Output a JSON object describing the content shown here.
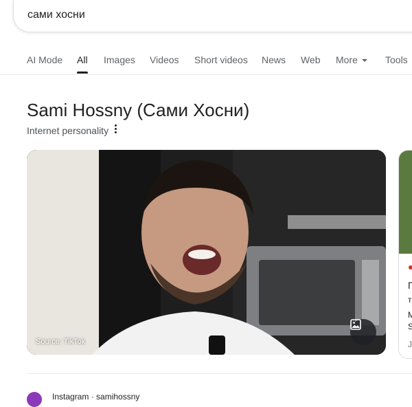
{
  "search": {
    "query": "сами хосни"
  },
  "tabs": [
    {
      "label": "AI Mode"
    },
    {
      "label": "All",
      "active": true
    },
    {
      "label": "Images"
    },
    {
      "label": "Videos"
    },
    {
      "label": "Short videos"
    },
    {
      "label": "News"
    },
    {
      "label": "Web"
    },
    {
      "label": "More"
    },
    {
      "label": "Tools"
    }
  ],
  "entity": {
    "title": "Sami Hossny (Сами Хосни)",
    "subtitle": "Internet personality"
  },
  "image_card": {
    "source": "Source: TikTok"
  },
  "next_card": {
    "line1": "П",
    "line2": "т",
    "line3": "М",
    "line4": "S",
    "line5": "J"
  },
  "result": {
    "site": "Instagram · samihossny"
  },
  "colors": {
    "tab_active": "#202124",
    "tab_inactive": "#5f6368",
    "border": "#dfe1e5"
  }
}
